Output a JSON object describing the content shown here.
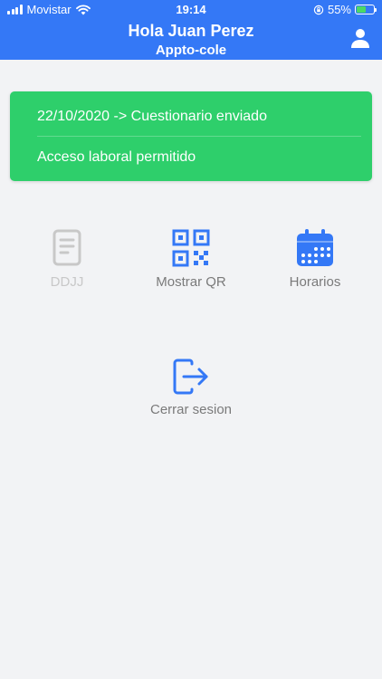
{
  "status_bar": {
    "carrier": "Movistar",
    "time": "19:14",
    "battery_percent": "55%",
    "battery_level": 0.55,
    "battery_color": "#4cd964"
  },
  "header": {
    "title": "Hola Juan Perez",
    "subtitle": "Appto-cole",
    "background": "#3478f6",
    "profile_icon": "user-icon"
  },
  "status_card": {
    "line1": "22/10/2020 -> Cuestionario enviado",
    "line2": "Acceso laboral permitido",
    "background": "#2ecf6b"
  },
  "menu": {
    "ddjj": {
      "label": "DDJJ",
      "icon": "document-icon",
      "enabled": false
    },
    "qr": {
      "label": "Mostrar QR",
      "icon": "qr-code-icon",
      "enabled": true
    },
    "schedule": {
      "label": "Horarios",
      "icon": "calendar-icon",
      "enabled": true
    },
    "logout": {
      "label": "Cerrar sesion",
      "icon": "logout-icon",
      "enabled": true
    }
  },
  "colors": {
    "accent": "#3478f6",
    "disabled": "#c8c8c8",
    "label": "#7a7a7a"
  }
}
